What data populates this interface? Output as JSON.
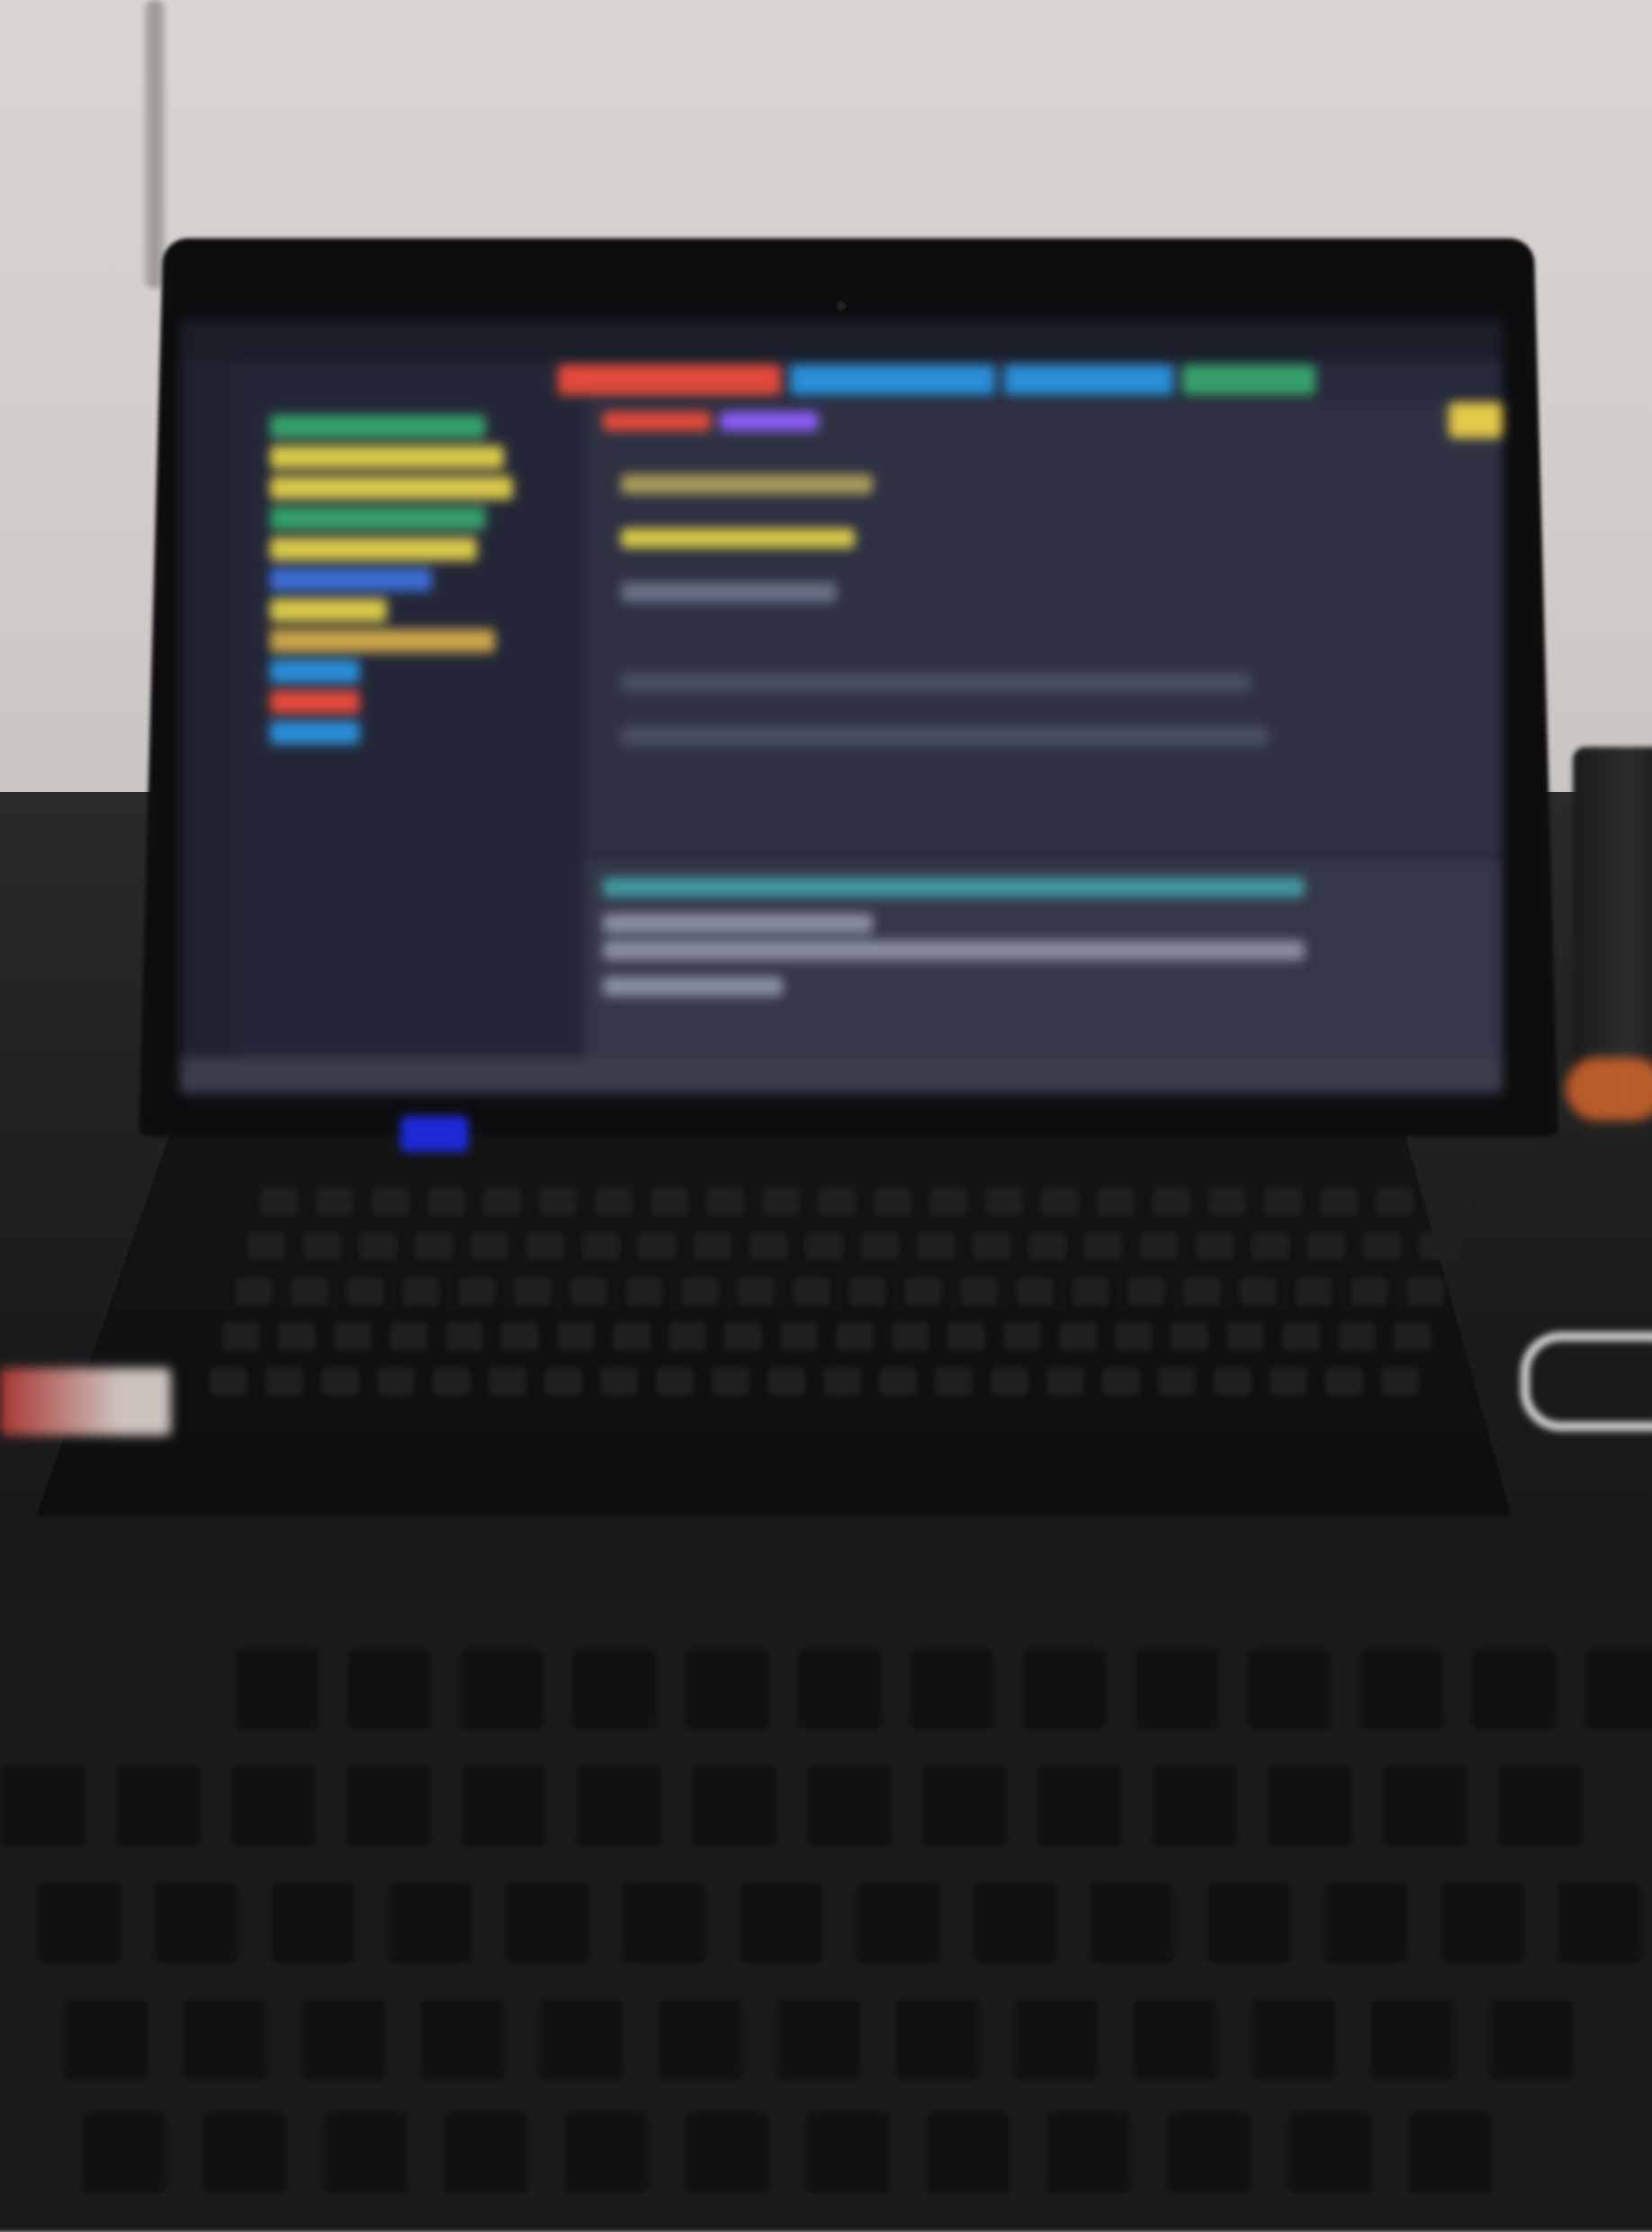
{
  "scene": {
    "description_type": "photo",
    "subject": "laptop-and-keyboard"
  },
  "laptop": {
    "screen": {
      "theme": "dark",
      "accent_colors": [
        "#e24a3b",
        "#2a8ed8",
        "#d8c84a",
        "#36a06a",
        "#8b5cf6",
        "#46c2c4"
      ]
    },
    "power_led_color": "#1d2ad6"
  },
  "keyboard": {
    "color": "#1b1b1c"
  }
}
